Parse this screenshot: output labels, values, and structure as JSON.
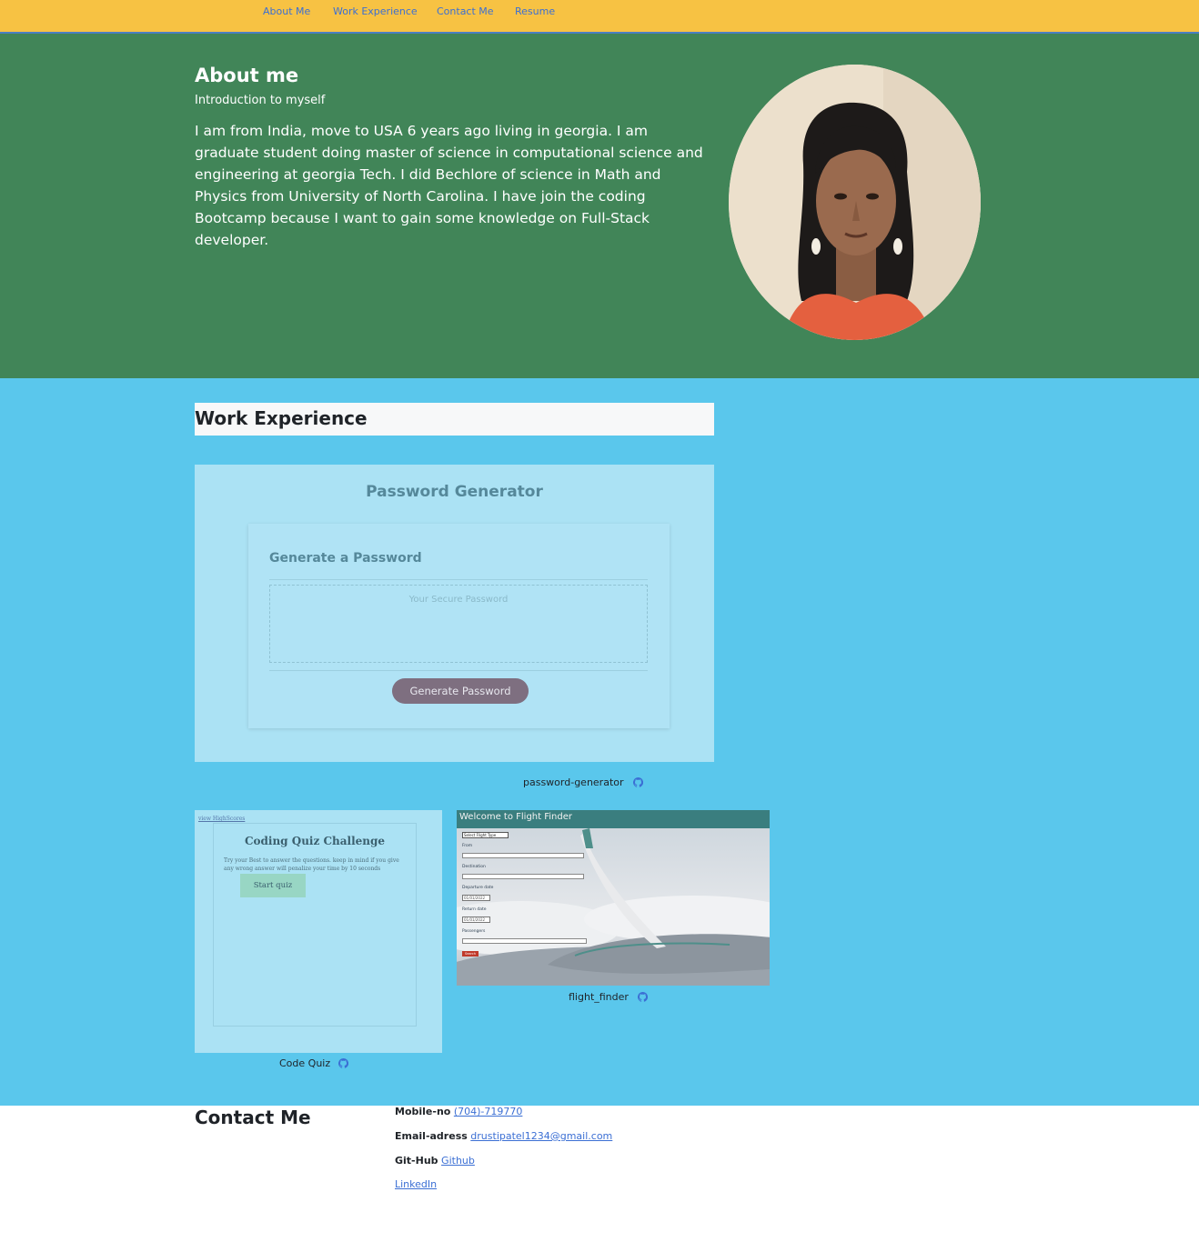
{
  "nav": {
    "items": [
      {
        "label": "About Me"
      },
      {
        "label": "Work Experience"
      },
      {
        "label": "Contact Me"
      },
      {
        "label": "Resume"
      }
    ]
  },
  "about": {
    "title": "About me",
    "subtitle": "Introduction to myself",
    "body": "I am from India, move to USA 6 years ago living in georgia. I am graduate student doing master of science in computational science and engineering at georgia Tech. I did Bechlore of science in Math and Physics from University of North Carolina. I have join the coding Bootcamp because I want to gain some knowledge on Full-Stack developer.",
    "avatar_icon": "profile-photo"
  },
  "work": {
    "title": "Work Experience",
    "projects": [
      {
        "caption": "password-generator",
        "icon": "github-icon",
        "screenshot": {
          "heading": "Password Generator",
          "card_title": "Generate a Password",
          "placeholder": "Your Secure Password",
          "button": "Generate Password"
        }
      },
      {
        "caption": "Code Quiz",
        "icon": "github-icon",
        "screenshot": {
          "link": "view HighScores",
          "heading": "Coding Quiz Challenge",
          "body": "Try your Best to answer the questions. keep in mind if you give any wrong answer will penalize your time by 10 seconds",
          "button": "Start quiz"
        }
      },
      {
        "caption": "flight_finder",
        "icon": "github-icon",
        "screenshot": {
          "heading": "Welcome to Flight Finder",
          "select": "Select Flight Type",
          "from": "From",
          "destination": "Destination",
          "departure": "Departure date",
          "return": "Return date",
          "passengers": "Passengers",
          "date_value": "01/01/2022",
          "search": "Search"
        }
      }
    ]
  },
  "contact": {
    "title": "Contact Me",
    "mobile_label": "Mobile-no",
    "mobile_value": "(704)-719770",
    "email_label": "Email-adress",
    "email_value": "drustipatel1234@gmail.com",
    "github_label": "Git-Hub",
    "github_value": "Github",
    "linkedin_value": "LinkedIn"
  },
  "colors": {
    "nav_bg": "#f7c243",
    "about_bg": "#418558",
    "work_bg": "#5ac7ec",
    "link": "#3b6fd4"
  }
}
